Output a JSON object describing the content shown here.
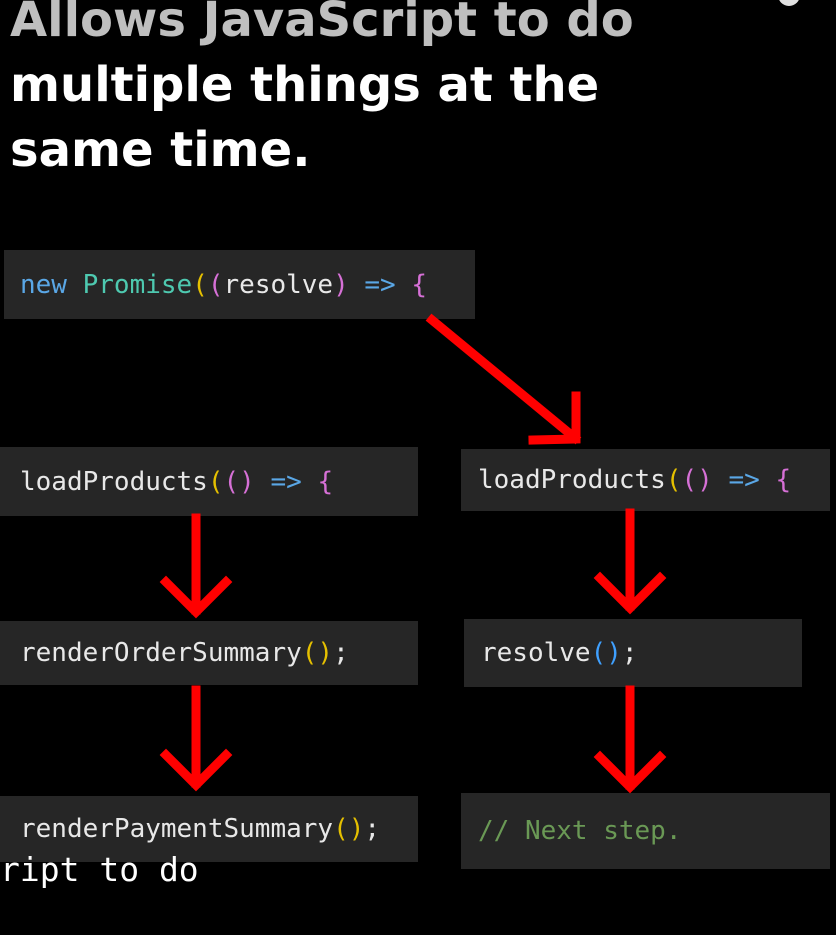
{
  "heading": {
    "line1": "Allows JavaScript to do",
    "line2": "multiple things at the",
    "line3": "same time."
  },
  "promise_box": {
    "kw_new": "new",
    "cls_promise": "Promise",
    "paren_open": "(",
    "paren_open2": "(",
    "param": "resolve",
    "paren_close2": ")",
    "arrow": "=>",
    "brace": "{"
  },
  "left_column": {
    "load": {
      "name": "loadProducts",
      "paren_open": "(",
      "paren_open2": "(",
      "paren_close2": ")",
      "arrow": "=>",
      "brace": "{"
    },
    "render_order": {
      "name": "renderOrderSummary",
      "parens": "()",
      "semi": ";"
    },
    "render_payment": {
      "name": "renderPaymentSummary",
      "parens": "()",
      "semi": ";"
    }
  },
  "right_column": {
    "load": {
      "name": "loadProducts",
      "paren_open": "(",
      "paren_open2": "(",
      "paren_close2": ")",
      "arrow": "=>",
      "brace": "{"
    },
    "resolve_call": {
      "name": "resolve",
      "parens": "()",
      "semi": ";"
    },
    "comment": "// Next step."
  },
  "subtitle": "ript to do",
  "colors": {
    "background": "#000000",
    "box": "#262626",
    "arrow_red": "#ff0000"
  }
}
